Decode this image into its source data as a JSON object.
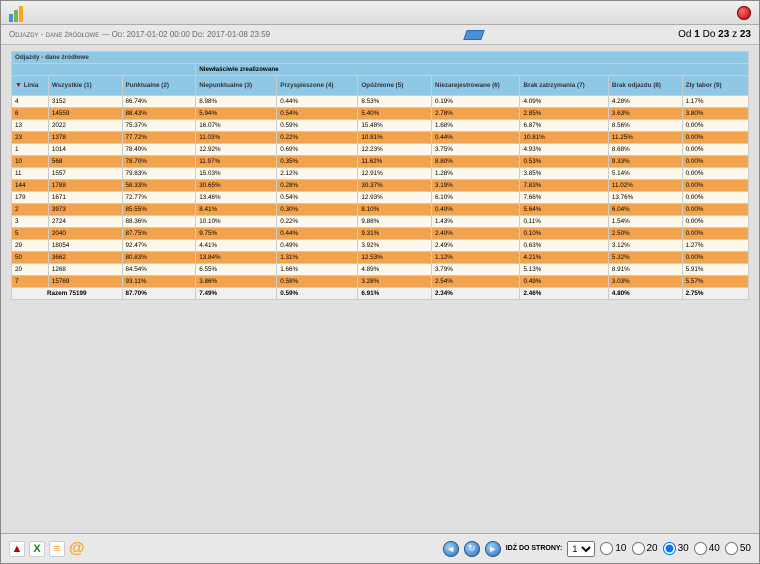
{
  "header": {
    "left_text": "Odjazdy - dane źródłowe — Od: 2017-01-02 00:00 Do: 2017-01-08 23:59",
    "right_prefix": "Od",
    "right_from": "1",
    "right_mid": "Do",
    "right_to": "23",
    "right_z": "z",
    "right_total": "23"
  },
  "table": {
    "title": "Odjazdy - dane źródłowe",
    "subtitle": "Niewłaściwie zrealizowane",
    "columns": {
      "linia": "Linia",
      "wszystkie": "Wszystkie (1)",
      "punktualne": "Punktualne (2)",
      "niepunktualne": "Niepunktualne (3)",
      "przyspieszone": "Przyspieszone (4)",
      "opoznione": "Opóźnione (5)",
      "niezarejestrowane": "Niezarejestrowane (6)",
      "brak_zatrzymania": "Brak zatrzymania (7)",
      "brak_odjazdu": "Brak odjazdu (8)",
      "zly_tabor": "Zły tabor (9)"
    },
    "rows": [
      {
        "c": [
          "4",
          "3152",
          "86.74%",
          "8.98%",
          "0.44%",
          "8.53%",
          "0.19%",
          "4.09%",
          "4.28%",
          "1.17%"
        ]
      },
      {
        "c": [
          "6",
          "14559",
          "88.43%",
          "5.94%",
          "0.54%",
          "5.40%",
          "2.78%",
          "2.85%",
          "3.63%",
          "3.80%"
        ]
      },
      {
        "c": [
          "13",
          "2022",
          "75.37%",
          "16.07%",
          "0.59%",
          "15.48%",
          "1.68%",
          "6.87%",
          "8.56%",
          "0.00%"
        ]
      },
      {
        "c": [
          "23",
          "1378",
          "77.72%",
          "11.03%",
          "0.22%",
          "10.81%",
          "0.44%",
          "10.81%",
          "11.25%",
          "0.00%"
        ]
      },
      {
        "c": [
          "1",
          "1014",
          "78.40%",
          "12.92%",
          "0.69%",
          "12.23%",
          "3.75%",
          "4.93%",
          "8.68%",
          "0.00%"
        ]
      },
      {
        "c": [
          "10",
          "568",
          "78.70%",
          "11.97%",
          "0.35%",
          "11.62%",
          "8.80%",
          "0.53%",
          "9.33%",
          "0.00%"
        ]
      },
      {
        "c": [
          "11",
          "1557",
          "79.83%",
          "15.03%",
          "2.12%",
          "12.91%",
          "1.28%",
          "3.85%",
          "5.14%",
          "0.00%"
        ]
      },
      {
        "c": [
          "144",
          "1788",
          "58.33%",
          "30.65%",
          "0.28%",
          "30.37%",
          "3.19%",
          "7.83%",
          "11.02%",
          "0.00%"
        ]
      },
      {
        "c": [
          "179",
          "1671",
          "72.77%",
          "13.46%",
          "0.54%",
          "12.93%",
          "6.10%",
          "7.66%",
          "13.76%",
          "0.00%"
        ]
      },
      {
        "c": [
          "2",
          "3973",
          "85.55%",
          "8.41%",
          "0.30%",
          "8.10%",
          "0.40%",
          "5.64%",
          "6.04%",
          "0.00%"
        ]
      },
      {
        "c": [
          "3",
          "2724",
          "88.36%",
          "10.10%",
          "0.22%",
          "9.88%",
          "1.43%",
          "0.11%",
          "1.54%",
          "0.00%"
        ]
      },
      {
        "c": [
          "5",
          "2040",
          "87.75%",
          "9.75%",
          "0.44%",
          "9.31%",
          "2.40%",
          "0.10%",
          "2.50%",
          "0.00%"
        ]
      },
      {
        "c": [
          "29",
          "18054",
          "92.47%",
          "4.41%",
          "0.49%",
          "3.92%",
          "2.49%",
          "0.63%",
          "3.12%",
          "1.27%"
        ]
      },
      {
        "c": [
          "50",
          "3662",
          "80.83%",
          "13.84%",
          "1.31%",
          "12.53%",
          "1.12%",
          "4.21%",
          "5.32%",
          "0.00%"
        ]
      },
      {
        "c": [
          "20",
          "1268",
          "84.54%",
          "6.55%",
          "1.66%",
          "4.89%",
          "3.79%",
          "5.13%",
          "8.91%",
          "5.91%"
        ]
      },
      {
        "c": [
          "7",
          "15769",
          "93.11%",
          "3.86%",
          "0.58%",
          "3.28%",
          "2.54%",
          "0.49%",
          "3.03%",
          "5.57%"
        ]
      }
    ],
    "total": {
      "label": "Razem 75199",
      "c": [
        "",
        "87.70%",
        "7.49%",
        "0.59%",
        "6.91%",
        "2.34%",
        "2.46%",
        "4.80%",
        "2.75%"
      ]
    }
  },
  "footer": {
    "goto_label": "IDŹ DO STRONY:",
    "goto_value": "1",
    "sizes": [
      "10",
      "20",
      "30",
      "40",
      "50"
    ],
    "selected_size": "30"
  }
}
